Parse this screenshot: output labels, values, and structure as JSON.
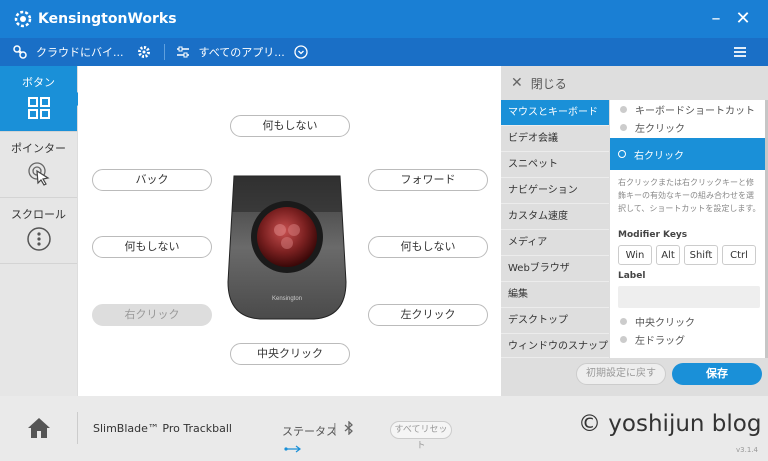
{
  "app": {
    "title": "KensingtonWorks"
  },
  "toolbar": {
    "profile": "クラウドにバイ...",
    "apps": "すべてのアプリ..."
  },
  "sidebar": {
    "items": [
      {
        "label": "ボタン"
      },
      {
        "label": "ポインター"
      },
      {
        "label": "スクロール"
      }
    ]
  },
  "mapping": {
    "top": "何もしない",
    "upper_left": "バック",
    "upper_right": "フォワード",
    "mid_left": "何もしない",
    "mid_right": "何もしない",
    "lower_left": "右クリック",
    "lower_right": "左クリック",
    "bottom": "中央クリック"
  },
  "device": {
    "brand": "Kensington"
  },
  "panel": {
    "close": "閉じる",
    "categories": [
      "マウスとキーボード",
      "ビデオ会議",
      "スニペット",
      "ナビゲーション",
      "カスタム速度",
      "メディア",
      "Webブラウザ",
      "編集",
      "デスクトップ",
      "ウィンドウのスナップ"
    ],
    "options_top": [
      "キーボードショートカット",
      "左クリック"
    ],
    "selected": "右クリック",
    "description": "右クリックまたは右クリックキーと修飾キーの有効なキーの組み合わせを選択して、ショートカットを設定します。",
    "modifier_title": "Modifier Keys",
    "modifiers": [
      "Win",
      "Alt",
      "Shift",
      "Ctrl"
    ],
    "label_title": "Label",
    "options_bottom": [
      "中央クリック",
      "左ドラッグ"
    ],
    "reset": "初期設定に戻す",
    "save": "保存"
  },
  "footer": {
    "device_name": "SlimBlade™ Pro Trackball",
    "status": "ステータス",
    "reset_all": "すべてリセット",
    "watermark": "© yoshijun blog",
    "version": "v3.1.4"
  },
  "colors": {
    "accent": "#1a90d8",
    "titlebar": "#1a7fd4"
  }
}
